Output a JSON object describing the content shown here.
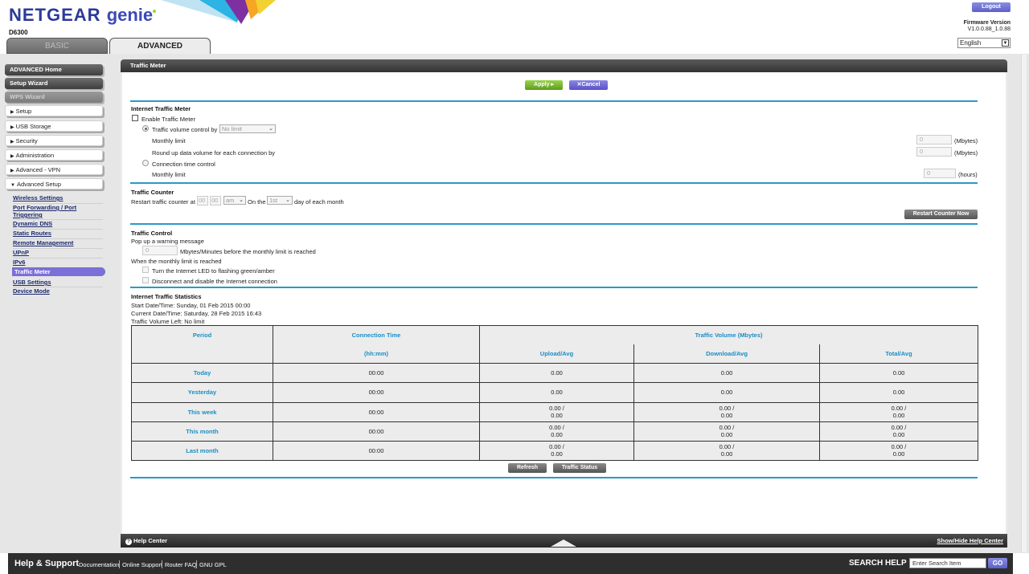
{
  "header": {
    "brand_main": "NETGEAR",
    "brand_sub": "genie",
    "model": "D6300",
    "tabs": [
      {
        "label": "BASIC"
      },
      {
        "label": "ADVANCED"
      }
    ],
    "logout_label": "Logout",
    "firmware_label": "Firmware Version",
    "firmware_value": "V1.0.0.88_1.0.88",
    "language": "English",
    "logo_colors": [
      "#2db3e4",
      "#7e2fa1",
      "#f5a623",
      "#f2d230"
    ]
  },
  "sidebar": {
    "buttons": [
      {
        "label": "ADVANCED Home"
      },
      {
        "label": "Setup Wizard"
      },
      {
        "label": "WPS Wizard"
      }
    ],
    "menus": [
      {
        "label": "Setup"
      },
      {
        "label": "USB Storage"
      },
      {
        "label": "Security"
      },
      {
        "label": "Administration"
      },
      {
        "label": "Advanced - VPN"
      },
      {
        "label": "Advanced Setup"
      }
    ],
    "submenu": [
      {
        "label": "Wireless Settings"
      },
      {
        "label": "Port Forwarding / Port"
      },
      {
        "label": "Triggering"
      },
      {
        "label": "Dynamic DNS"
      },
      {
        "label": "Static Routes"
      },
      {
        "label": "Remote Management"
      },
      {
        "label": "UPnP"
      },
      {
        "label": "IPv6"
      },
      {
        "label": "Traffic Meter"
      },
      {
        "label": "USB Settings"
      },
      {
        "label": "Device Mode"
      }
    ]
  },
  "panel": {
    "title": "Traffic Meter",
    "apply_label": "Apply ▸",
    "cancel_label": "Cancel",
    "itm": {
      "heading": "Internet Traffic Meter",
      "enable_label": "Enable Traffic Meter",
      "volume_control_label": "Traffic volume control by",
      "volume_control_value": "No limit",
      "monthly_limit_label": "Monthly limit",
      "monthly_limit_value": "0",
      "round_up_label": "Round up data volume for each connection by",
      "round_up_value": "0",
      "mbytes_unit": "(Mbytes)",
      "connection_time_label": "Connection time control",
      "conn_monthly_limit_label": "Monthly limit",
      "conn_monthly_limit_value": "0",
      "hours_unit": "(hours)"
    },
    "counter": {
      "heading": "Traffic Counter",
      "restart_label": "Restart traffic counter at",
      "hour": "00",
      "minute": "00",
      "ampm": "am",
      "on_the": "On the",
      "day": "1st",
      "day_suffix": "day of each month",
      "restart_now_label": "Restart Counter Now"
    },
    "control": {
      "heading": "Traffic Control",
      "popup_label": "Pop up a warning message",
      "popup_value": "0",
      "popup_suffix": "Mbytes/Minutes before the monthly limit is reached",
      "when_reached": "When the monthly limit is reached",
      "led_label": "Turn the Internet LED to flashing green/amber",
      "disconnect_label": "Disconnect and disable the Internet connection"
    },
    "stats": {
      "heading": "Internet Traffic Statistics",
      "start_line": "Start Date/Time: Sunday, 01 Feb 2015 00:00",
      "current_line": "Current Date/Time: Saturday, 28 Feb 2015 16:43",
      "left_line": "Traffic Volume Left: No limit",
      "headers": {
        "period": "Period",
        "connection_time": "Connection Time",
        "hhmm": "(hh:mm)",
        "traffic_volume": "Traffic Volume (Mbytes)",
        "upload": "Upload/Avg",
        "download": "Download/Avg",
        "total": "Total/Avg"
      },
      "rows": [
        {
          "period": "Today",
          "time": "00:00",
          "up1": "0.00",
          "up2": "",
          "down1": "0.00",
          "down2": "",
          "total1": "0.00",
          "total2": ""
        },
        {
          "period": "Yesterday",
          "time": "00:00",
          "up1": "0.00",
          "up2": "",
          "down1": "0.00",
          "down2": "",
          "total1": "0.00",
          "total2": ""
        },
        {
          "period": "This week",
          "time": "00:00",
          "up1": "0.00 /",
          "up2": "0.00",
          "down1": "0.00 /",
          "down2": "0.00",
          "total1": "0.00 /",
          "total2": "0.00"
        },
        {
          "period": "This month",
          "time": "00:00",
          "up1": "0.00 /",
          "up2": "0.00",
          "down1": "0.00 /",
          "down2": "0.00",
          "total1": "0.00 /",
          "total2": "0.00"
        },
        {
          "period": "Last month",
          "time": "00:00",
          "up1": "0.00 /",
          "up2": "0.00",
          "down1": "0.00 /",
          "down2": "0.00",
          "total1": "0.00 /",
          "total2": "0.00"
        }
      ],
      "refresh_label": "Refresh",
      "traffic_status_label": "Traffic Status"
    },
    "footer": {
      "help_center": "Help Center",
      "show_hide": "Show/Hide Help Center"
    }
  },
  "bottom": {
    "title": "Help & Support",
    "links": [
      {
        "label": "Documentation"
      },
      {
        "label": "Online Support"
      },
      {
        "label": "Router FAQ"
      },
      {
        "label": "GNU GPL"
      }
    ],
    "search_label": "SEARCH HELP",
    "search_placeholder": "Enter Search Item",
    "go_label": "GO"
  }
}
